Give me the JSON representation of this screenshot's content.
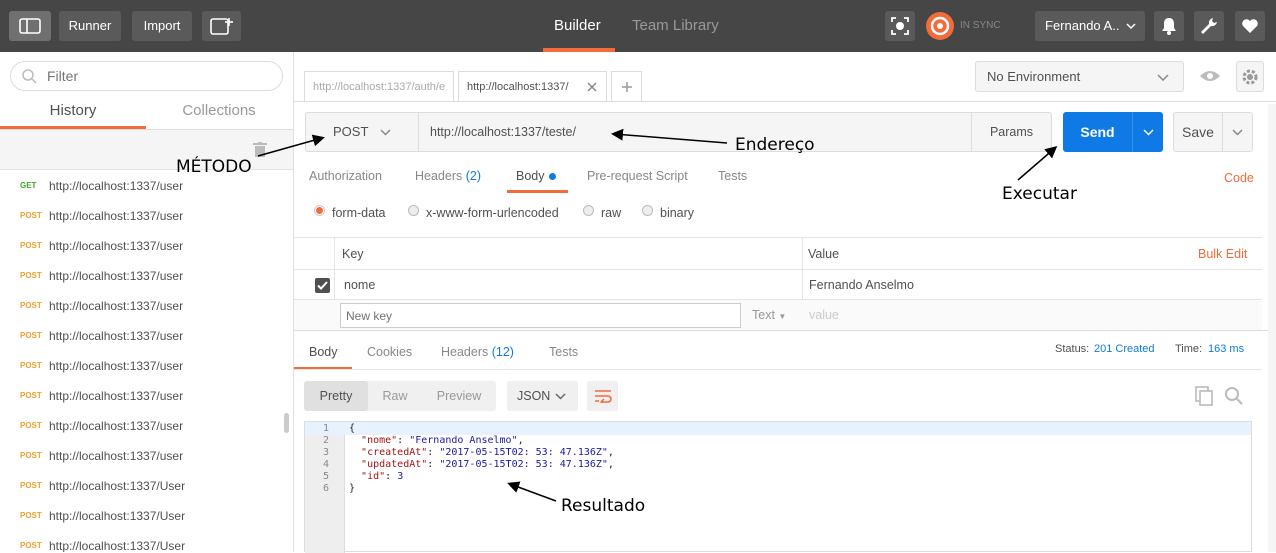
{
  "topbar": {
    "runner_label": "Runner",
    "import_label": "Import",
    "builder_tab": "Builder",
    "team_library_tab": "Team Library",
    "sync_status": "IN SYNC",
    "user_name": "Fernando A..",
    "colors": {
      "bar": "#464646",
      "active_tab_underline": "#f26b3a",
      "sync_orange": "#f26b3a"
    }
  },
  "sidebar": {
    "filter_placeholder": "Filter",
    "tabs": {
      "history": "History",
      "collections": "Collections"
    },
    "items": [
      {
        "method": "GET",
        "url": "http://localhost:1337/user"
      },
      {
        "method": "POST",
        "url": "http://localhost:1337/user"
      },
      {
        "method": "POST",
        "url": "http://localhost:1337/user"
      },
      {
        "method": "POST",
        "url": "http://localhost:1337/user"
      },
      {
        "method": "POST",
        "url": "http://localhost:1337/user"
      },
      {
        "method": "POST",
        "url": "http://localhost:1337/user"
      },
      {
        "method": "POST",
        "url": "http://localhost:1337/user"
      },
      {
        "method": "POST",
        "url": "http://localhost:1337/user"
      },
      {
        "method": "POST",
        "url": "http://localhost:1337/user"
      },
      {
        "method": "POST",
        "url": "http://localhost:1337/user"
      },
      {
        "method": "POST",
        "url": "http://localhost:1337/User"
      },
      {
        "method": "POST",
        "url": "http://localhost:1337/User"
      },
      {
        "method": "POST",
        "url": "http://localhost:1337/User"
      }
    ]
  },
  "request_tabs": [
    {
      "label": "http://localhost:1337/auth/e"
    },
    {
      "label": "http://localhost:1337/"
    }
  ],
  "environment": {
    "selected": "No Environment"
  },
  "request": {
    "method": "POST",
    "url": "http://localhost:1337/teste/",
    "params_label": "Params",
    "send_label": "Send",
    "save_label": "Save"
  },
  "request_subtabs": {
    "authorization": "Authorization",
    "headers": "Headers",
    "headers_count": "(2)",
    "body": "Body",
    "pre_request": "Pre-request Script",
    "tests": "Tests",
    "code": "Code"
  },
  "body_modes": {
    "form_data": "form-data",
    "urlencoded": "x-www-form-urlencoded",
    "raw": "raw",
    "binary": "binary"
  },
  "form_table": {
    "key_header": "Key",
    "value_header": "Value",
    "bulk_edit": "Bulk Edit",
    "rows": [
      {
        "key": "nome",
        "value": "Fernando Anselmo"
      }
    ],
    "new_key_placeholder": "New key",
    "type_label": "Text",
    "value_placeholder": "value"
  },
  "response": {
    "tabs": {
      "body": "Body",
      "cookies": "Cookies",
      "headers": "Headers",
      "headers_count": "(12)",
      "tests": "Tests"
    },
    "status_label": "Status:",
    "status_value": "201 Created",
    "time_label": "Time:",
    "time_value": "163 ms",
    "view_modes": {
      "pretty": "Pretty",
      "raw": "Raw",
      "preview": "Preview"
    },
    "format": "JSON",
    "code_lines": [
      {
        "num": "1",
        "text": "{"
      },
      {
        "num": "2",
        "text": "  \"nome\": \"Fernando Anselmo\","
      },
      {
        "num": "3",
        "text": "  \"createdAt\": \"2017-05-15T02:53:47.136Z\","
      },
      {
        "num": "4",
        "text": "  \"updatedAt\": \"2017-05-15T02:53:47.136Z\","
      },
      {
        "num": "5",
        "text": "  \"id\": 3"
      },
      {
        "num": "6",
        "text": "}"
      }
    ]
  },
  "annotations": {
    "metodo": "MÉTODO",
    "endereco": "Endereço",
    "executar": "Executar",
    "resultado": "Resultado"
  },
  "icons": [
    "sidebar-toggle-icon",
    "new-window-icon",
    "interceptor-icon",
    "sync-icon",
    "chevron-down-icon",
    "bell-icon",
    "wrench-icon",
    "heart-icon",
    "search-icon",
    "trash-icon",
    "eye-icon",
    "gear-icon",
    "close-icon",
    "plus-icon",
    "wrap-icon",
    "copy-icon",
    "checkbox-icon"
  ]
}
